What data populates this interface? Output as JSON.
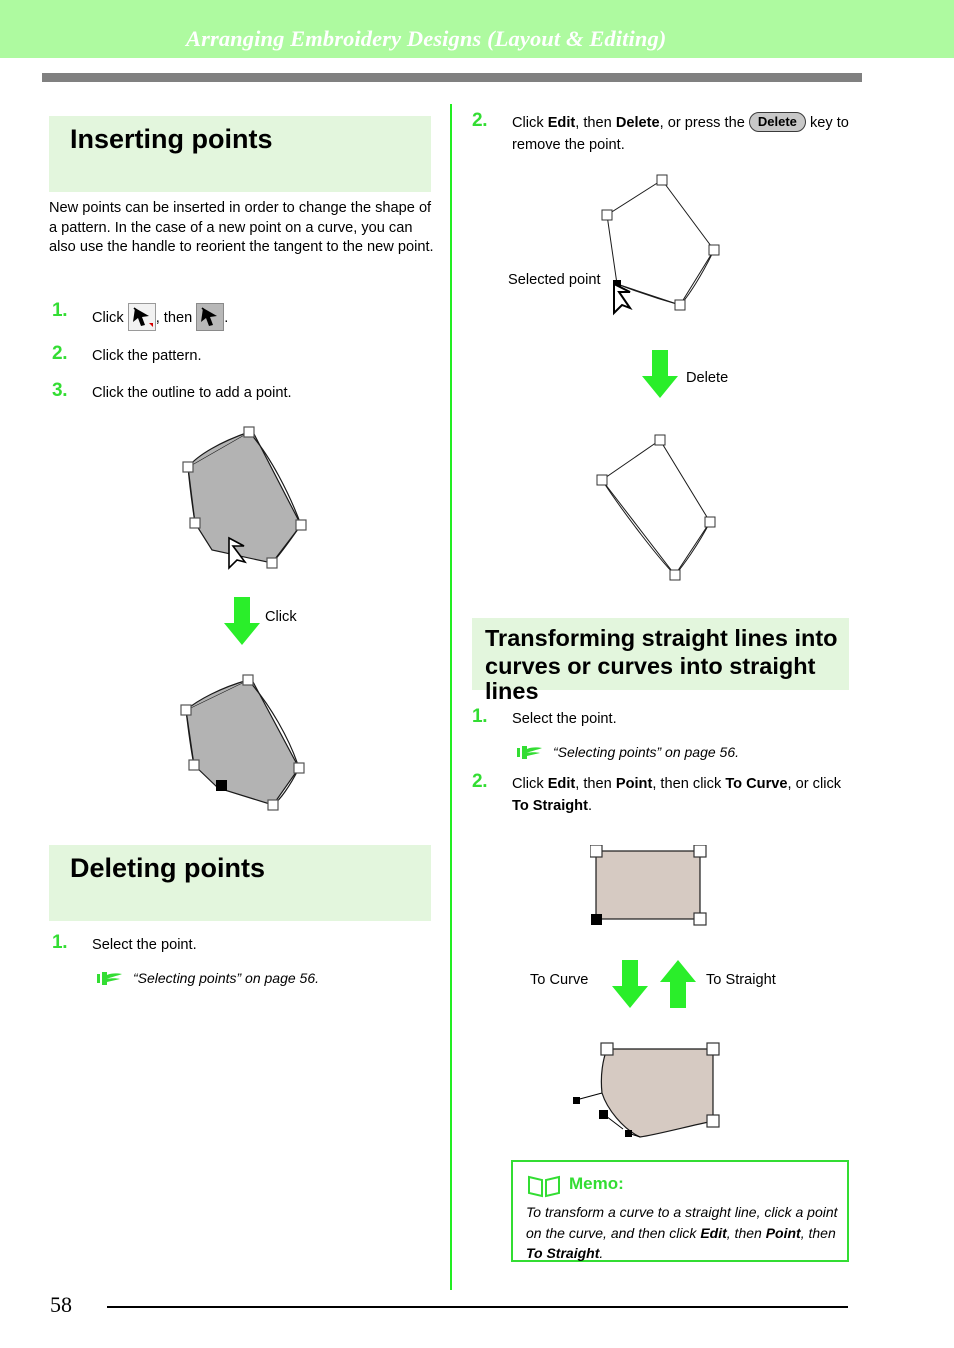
{
  "header": {
    "title": "Arranging Embroidery Designs (Layout & Editing)",
    "band_color": "#aefaa0",
    "title_color": "#ffffff",
    "rule_color": "#808080"
  },
  "colors": {
    "section_head_bg": "#e3f6dd",
    "step_number_green": "#33dd33",
    "divider_green": "#22ee22",
    "arrow_green": "#2aee2a",
    "memo_green": "#33dd33",
    "shape_gray_fill": "#b3b3b3",
    "shape_beige_fill": "#d6cac2"
  },
  "left_column": {
    "section1": {
      "heading": "Inserting points",
      "intro": "New points can be inserted in order to change the shape of a pattern. In the case of a new point on a curve, you can also use the handle to reorient the tangent to the new point.",
      "steps": [
        {
          "num": "1.",
          "text_before": "Click",
          "text_middle": ", then",
          "text_after": "."
        },
        {
          "num": "2.",
          "text": "Click the pattern."
        },
        {
          "num": "3.",
          "text": "Click the outline to add a point."
        }
      ],
      "figure_arrow_label": "Click"
    },
    "section2": {
      "heading": "Deleting points",
      "steps": [
        {
          "num": "1.",
          "text": "Select the point."
        }
      ],
      "xref": "“Selecting points” on page 56."
    }
  },
  "right_column": {
    "step2_delete": {
      "num": "2.",
      "line1_a": "Click ",
      "line1_bold1": "Edit",
      "line1_b": ", then ",
      "line1_bold2": "Delete",
      "line1_c": ", or press the ",
      "key_label": "Delete",
      "line2": "key to remove the point."
    },
    "figure_selected_point_label": "Selected point",
    "figure_arrow_label": "Delete",
    "section3": {
      "heading_line1": "Transforming straight lines into",
      "heading_line2": "curves or curves into straight lines",
      "steps": [
        {
          "num": "1.",
          "text": "Select the point."
        },
        {
          "num": "2.",
          "text_a": "Click ",
          "bold1": "Edit",
          "text_b": ", then ",
          "bold2": "Point",
          "text_c": ", then click ",
          "bold3": "To Curve",
          "text_d": ", or",
          "line2_a": "click ",
          "line2_bold": "To Straight",
          "line2_b": "."
        }
      ],
      "xref": "“Selecting points” on page 56.",
      "arrow_label_left": "To Curve",
      "arrow_label_right": "To Straight"
    },
    "memo": {
      "title": "Memo:",
      "body_a": "To transform a curve to a straight line, click a point on the curve, and then click ",
      "body_bold1": "Edit",
      "body_b": ", then ",
      "body_bold2": "Point",
      "body_c": ", then ",
      "body_bold3": "To Straight",
      "body_d": "."
    }
  },
  "footer": {
    "page_number": "58"
  }
}
